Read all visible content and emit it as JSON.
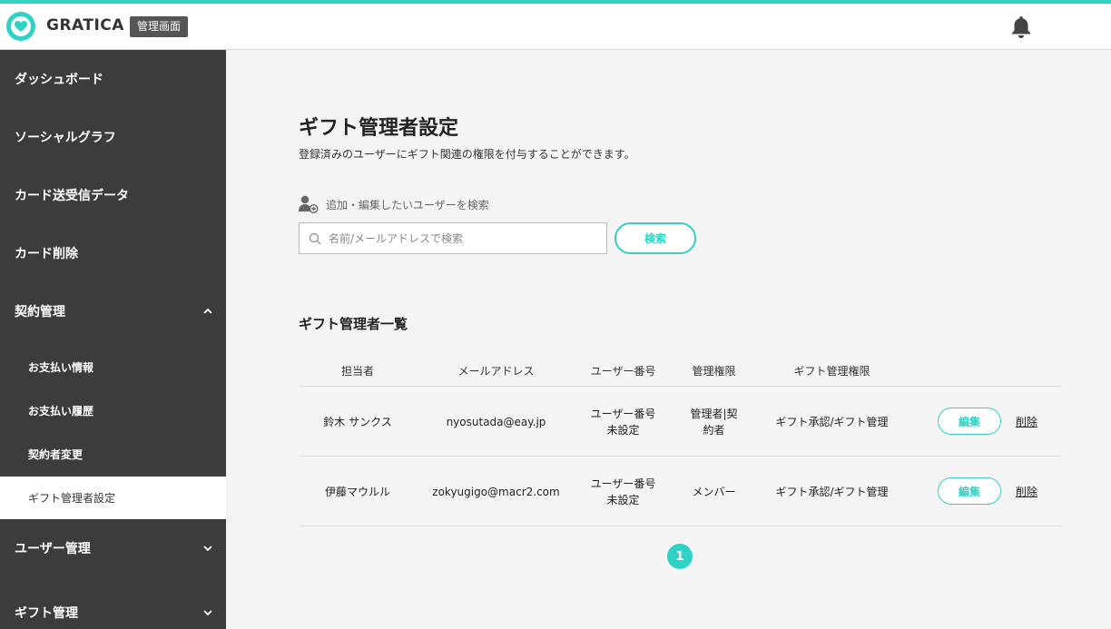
{
  "header": {
    "brand": "GRATICA",
    "badge": "管理画面",
    "accent_color": "#2ed3c6",
    "logo_icon": "heart-icon",
    "bell_icon": "bell-icon"
  },
  "sidebar": {
    "items": [
      {
        "label": "ダッシュボード"
      },
      {
        "label": "ソーシャルグラフ"
      },
      {
        "label": "カード送受信データ"
      },
      {
        "label": "カード削除"
      },
      {
        "label": "契約管理",
        "expanded": true
      },
      {
        "label": "お支払い情報"
      },
      {
        "label": "お支払い履歴"
      },
      {
        "label": "契約者変更"
      },
      {
        "label": "ギフト管理者設定",
        "active": true
      },
      {
        "label": "ユーザー管理",
        "expanded": false
      },
      {
        "label": "ギフト管理",
        "expanded": false
      }
    ]
  },
  "main": {
    "title": "ギフト管理者設定",
    "description": "登録済みのユーザーにギフト関連の権限を付与することができます。",
    "search": {
      "label": "追加・編集したいユーザーを検索",
      "placeholder": "名前/メールアドレスで検索",
      "value": "",
      "button": "検索"
    },
    "list_title": "ギフト管理者一覧",
    "table": {
      "columns": [
        "担当者",
        "メールアドレス",
        "ユーザー番号",
        "管理権限",
        "ギフト管理権限"
      ],
      "rows": [
        {
          "name": "鈴木 サンクス",
          "email": "nyosutada@eay.jp",
          "user_no_line1": "ユーザー番号",
          "user_no_line2": "未設定",
          "role_line1": "管理者|契",
          "role_line2": "約者",
          "gift_role": "ギフト承認/ギフト管理",
          "edit": "編集",
          "delete": "削除"
        },
        {
          "name": "伊藤マウルル",
          "email": "zokyugigo@macr2.com",
          "user_no_line1": "ユーザー番号",
          "user_no_line2": "未設定",
          "role_line1": "メンバー",
          "role_line2": "",
          "gift_role": "ギフト承認/ギフト管理",
          "edit": "編集",
          "delete": "削除"
        }
      ]
    },
    "pagination": {
      "current": "1"
    }
  }
}
